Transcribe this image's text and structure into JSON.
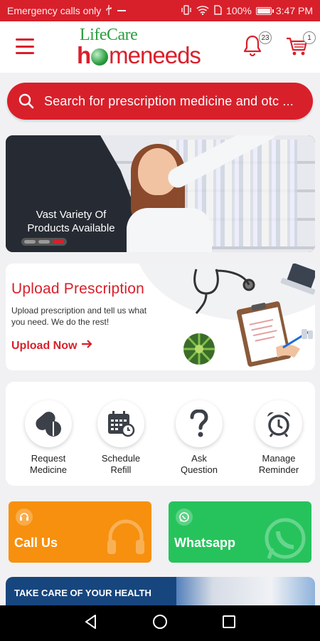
{
  "status_bar": {
    "left_text": "Emergency calls only",
    "battery": "100%",
    "time": "3:47 PM"
  },
  "header": {
    "logo_top": "LifeCare",
    "logo_bottom_a": "h",
    "logo_bottom_b": "meneeds",
    "notifications_count": "23",
    "cart_count": "1"
  },
  "search": {
    "placeholder": "Search for prescription medicine and otc ..."
  },
  "banner": {
    "caption": "Vast Variety Of Products Available"
  },
  "upload": {
    "title": "Upload Prescription",
    "description": "Upload prescription and tell us what you need. We do the rest!",
    "cta": "Upload Now"
  },
  "actions": [
    {
      "label_line1": "Request",
      "label_line2": "Medicine",
      "icon": "pills-icon"
    },
    {
      "label_line1": "Schedule",
      "label_line2": "Refill",
      "icon": "calendar-clock-icon"
    },
    {
      "label_line1": "Ask",
      "label_line2": "Question",
      "icon": "question-icon"
    },
    {
      "label_line1": "Manage",
      "label_line2": "Reminder",
      "icon": "alarm-clock-icon"
    }
  ],
  "contact": {
    "call_label": "Call Us",
    "whatsapp_label": "Whatsapp"
  },
  "health_banner": {
    "text": "TAKE CARE OF YOUR HEALTH"
  },
  "colors": {
    "brand_red": "#d8202b",
    "brand_green": "#2b9e3f",
    "call_orange": "#f7900e",
    "whatsapp_green": "#26c35c"
  }
}
